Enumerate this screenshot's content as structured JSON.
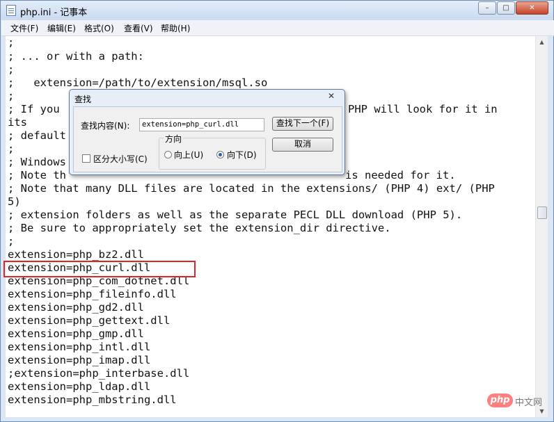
{
  "window": {
    "title": "php.ini - 记事本",
    "controls": {
      "minimize": "–",
      "maximize": "□",
      "close": "✕"
    }
  },
  "menu": [
    "文件(F)",
    "编辑(E)",
    "格式(O)",
    "查看(V)",
    "帮助(H)"
  ],
  "editor": {
    "lines": [
      ";",
      "; ... or with a path:",
      ";",
      ";   extension=/path/to/extension/msql.so",
      ";",
      "; If you",
      "its",
      "; default",
      ";",
      "; Windows",
      "; Note th",
      "; Note that many DLL files are located in the extensions/ (PHP 4) ext/ (PHP",
      "5)",
      "; extension folders as well as the separate PECL DLL download (PHP 5).",
      "; Be sure to appropriately set the extension_dir directive.",
      ";",
      "extension=php_bz2.dll",
      "extension=php_curl.dll",
      "extension=php_com_dotnet.dll",
      "extension=php_fileinfo.dll",
      "extension=php_gd2.dll",
      "extension=php_gettext.dll",
      "extension=php_gmp.dll",
      "extension=php_intl.dll",
      "extension=php_imap.dll",
      ";extension=php_interbase.dll",
      "extension=php_ldap.dll",
      "extension=php_mbstring.dll"
    ],
    "fragments": {
      "line6_right": "PHP will look for it in",
      "line11_right": "is needed for it."
    },
    "highlighted_line": "extension=php_curl.dll",
    "highlight_color": "#e02525"
  },
  "find_dialog": {
    "title": "查找",
    "close": "✕",
    "find_label": "查找内容(N):",
    "find_value": "extension=php_curl.dll",
    "find_next_button": "查找下一个(F)",
    "cancel_button": "取消",
    "direction_label": "方向",
    "direction_up": "向上(U)",
    "direction_down": "向下(D)",
    "direction_selected": "down",
    "match_case_label": "区分大小写(C)",
    "match_case_checked": false
  },
  "watermark": {
    "logo": "php",
    "text": "中文网"
  }
}
